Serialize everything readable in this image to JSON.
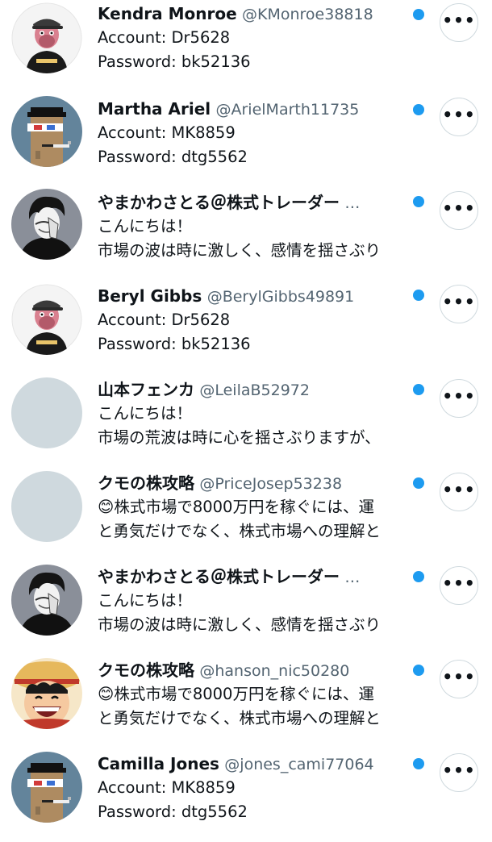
{
  "accounts": [
    {
      "name": "Kendra Monroe",
      "handle": "@KMonroe38818",
      "line1": "Account: Dr5628",
      "line2": "Password: bk52136",
      "avatar": "ape-avatar-icon"
    },
    {
      "name": "Martha Ariel",
      "handle": "@ArielMarth11735",
      "line1": "Account: MK8859",
      "line2": "Password: dtg5562",
      "avatar": "pixel-punk-avatar-icon"
    },
    {
      "name": "やまかわさとる＠株式トレーダー",
      "handle": "…",
      "line1": "こんにちは！",
      "line2": "市場の波は時に激しく、感情を揺さぶり",
      "avatar": "anime-man-avatar-icon"
    },
    {
      "name": "Beryl Gibbs",
      "handle": "@BerylGibbs49891",
      "line1": "Account: Dr5628",
      "line2": "Password: bk52136",
      "avatar": "ape-avatar-icon"
    },
    {
      "name": "山本フェンカ",
      "handle": "@LeilaB52972",
      "line1": "こんにちは！",
      "line2": "市場の荒波は時に心を揺さぶりますが、",
      "avatar": "blank-avatar-icon"
    },
    {
      "name": "クモの株攻略",
      "handle": "@PriceJosep53238",
      "line1": "😊株式市場で8000万円を稼ぐには、運",
      "line2": "と勇気だけでなく、株式市場への理解と",
      "avatar": "blank-avatar-icon"
    },
    {
      "name": "やまかわさとる＠株式トレーダー",
      "handle": "…",
      "line1": "こんにちは！",
      "line2": "市場の波は時に激しく、感情を揺さぶり",
      "avatar": "anime-man-avatar-icon"
    },
    {
      "name": "クモの株攻略",
      "handle": "@hanson_nic50280",
      "line1": "😊株式市場で8000万円を稼ぐには、運",
      "line2": "と勇気だけでなく、株式市場への理解と",
      "avatar": "straw-hat-avatar-icon"
    },
    {
      "name": "Camilla Jones",
      "handle": "@jones_cami77064",
      "line1": "Account: MK8859",
      "line2": "Password: dtg5562",
      "avatar": "pixel-punk-avatar-icon"
    }
  ],
  "more_button_label": "•••",
  "colors": {
    "verified_dot": "#1d9bf0",
    "handle_text": "#536471",
    "button_border": "#cfd9de",
    "blank_avatar": "#cfd9de"
  }
}
